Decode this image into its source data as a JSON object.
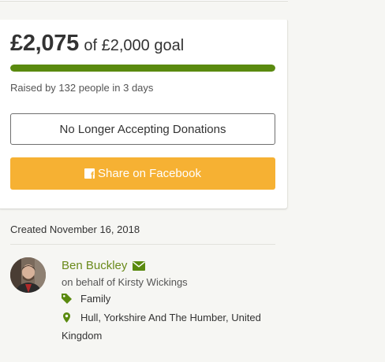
{
  "donation": {
    "amount_raised": "£2,075",
    "goal_text": "of £2,000 goal",
    "progress_fraction": 1.0,
    "raised_by_text": "Raised by 132 people in 3 days",
    "no_longer_label": "No Longer Accepting Donations",
    "share_label": "Share on Facebook"
  },
  "campaign": {
    "created_text": "Created November 16, 2018"
  },
  "organizer": {
    "name": "Ben Buckley",
    "behalf_text": "on behalf of Kirsty Wickings",
    "category": "Family",
    "location": "Hull, Yorkshire And The Humber, United Kingdom"
  },
  "colors": {
    "progress": "#5a8a0f",
    "share_button": "#f6b133",
    "organizer_link": "#6a8a1a",
    "icon_green": "#5a8a0f"
  },
  "icons": [
    "facebook-icon",
    "mail-icon",
    "tag-icon",
    "map-pin-icon"
  ]
}
